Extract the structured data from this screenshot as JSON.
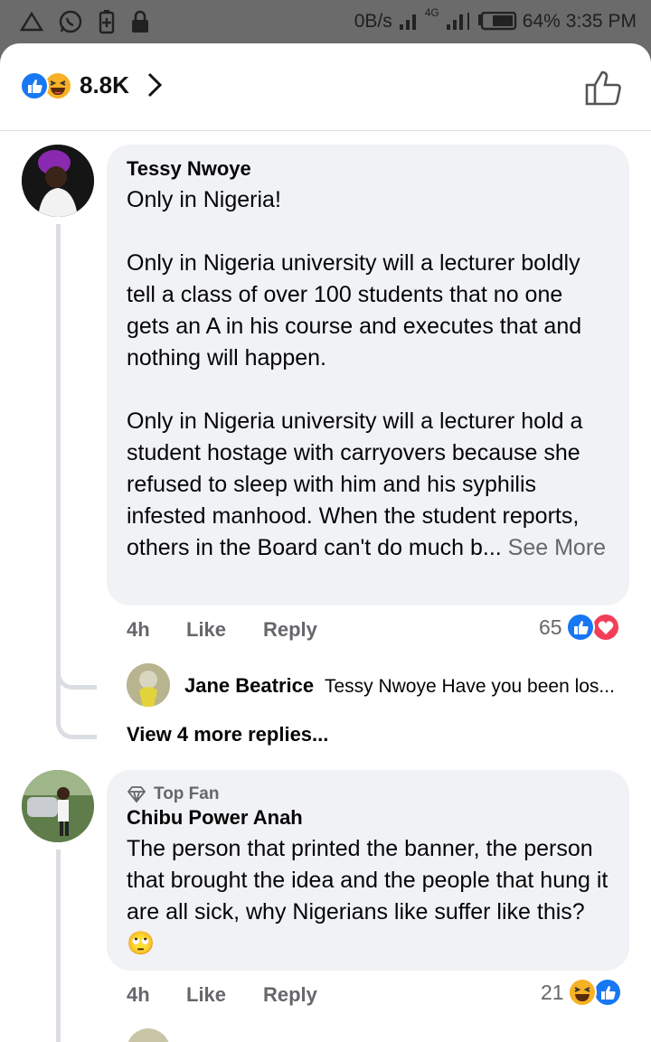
{
  "status_bar": {
    "network_speed": "0B/s",
    "network_type": "4G",
    "battery": "64%",
    "time": "3:35 PM",
    "icons": [
      "warning-icon",
      "whatsapp-icon",
      "battery-saver-icon",
      "lock-icon",
      "signal-icon",
      "battery-icon"
    ]
  },
  "post_reactions": {
    "icons": [
      "like-reaction-icon",
      "haha-reaction-icon"
    ],
    "count": "8.8K"
  },
  "comments": [
    {
      "author": "Tessy Nwoye",
      "text": "Only in Nigeria!\n\nOnly in Nigeria university will a lecturer boldly tell a class of over 100 students that no one gets an A in his course and executes that and nothing will happen.\n\nOnly in Nigeria university will a lecturer hold a student hostage with carryovers because she refused to sleep with him and his syphilis infested manhood. When the student reports, others in the Board can't do much b...",
      "see_more": " See More",
      "time": "4h",
      "like_label": "Like",
      "reply_label": "Reply",
      "reaction_count": "65",
      "reaction_icons": [
        "like-reaction-icon",
        "love-reaction-icon"
      ],
      "reply_preview": {
        "author": "Jane Beatrice",
        "text": "Tessy Nwoye Have you been los..."
      },
      "view_more": "View 4 more replies..."
    },
    {
      "badge": "Top Fan",
      "author": "Chibu Power Anah",
      "text": "The person that printed the banner, the person that brought the idea and the people that hung it are all sick, why Nigerians like suffer like this?",
      "emoji": "🙄",
      "time": "4h",
      "like_label": "Like",
      "reply_label": "Reply",
      "reaction_count": "21",
      "reaction_icons": [
        "haha-reaction-icon",
        "like-reaction-icon"
      ]
    }
  ],
  "colors": {
    "like_blue": "#1877f2",
    "love_red": "#f33e58",
    "haha_yellow": "#f7b125",
    "bubble_bg": "#f0f2f5",
    "meta_gray": "#65676b"
  }
}
